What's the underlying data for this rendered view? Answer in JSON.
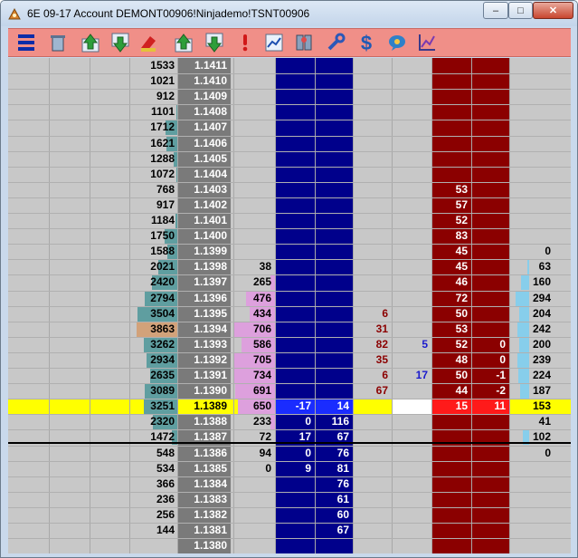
{
  "window": {
    "title": "6E 09-17  Account DEMONT00906!Ninjademo!TSNT00906",
    "controls": {
      "minimize": "–",
      "maximize": "□",
      "close": "✕"
    }
  },
  "toolbar": {
    "tools": [
      "center-ladder-icon",
      "trash-icon",
      "up-arrow-icon",
      "down-arrow-icon",
      "clear-orders-icon",
      "up-arrow-icon",
      "down-arrow-icon",
      "alert-icon",
      "chart-icon",
      "settings-icon",
      "wrench-icon",
      "dollar-icon",
      "chat-icon",
      "graph-icon"
    ]
  },
  "colors": {
    "price_col": "#7a7a7a",
    "buy_col": "#00008b",
    "sell_col": "#8b0000",
    "last_row": "#ffff00",
    "volume_bar": "#5f9ea0",
    "hi_vol_bar": "#d2a27a",
    "profile_bar": "#dda0dd",
    "right_bar": "#87ceeb"
  },
  "ladder": {
    "rows": [
      {
        "vol": "1533",
        "vbar": 0.0,
        "price": "1.1411"
      },
      {
        "vol": "1021",
        "vbar": 0.0,
        "price": "1.1410"
      },
      {
        "vol": "912",
        "vbar": 0.0,
        "price": "1.1409"
      },
      {
        "vol": "1101",
        "vbar": 0.05,
        "price": "1.1408"
      },
      {
        "vol": "1712",
        "vbar": 0.3,
        "price": "1.1407"
      },
      {
        "vol": "1621",
        "vbar": 0.28,
        "price": "1.1406"
      },
      {
        "vol": "1288",
        "vbar": 0.1,
        "price": "1.1405"
      },
      {
        "vol": "1072",
        "vbar": 0.05,
        "price": "1.1404"
      },
      {
        "vol": "768",
        "vbar": 0.0,
        "price": "1.1403",
        "sell": "53"
      },
      {
        "vol": "917",
        "vbar": 0.0,
        "price": "1.1402",
        "sell": "57"
      },
      {
        "vol": "1184",
        "vbar": 0.06,
        "price": "1.1401",
        "sell": "52"
      },
      {
        "vol": "1750",
        "vbar": 0.33,
        "price": "1.1400",
        "sell": "83"
      },
      {
        "vol": "1588",
        "vbar": 0.27,
        "price": "1.1399",
        "sell": "45",
        "r": "0"
      },
      {
        "vol": "2021",
        "vbar": 0.47,
        "price": "1.1398",
        "prof": "38",
        "sell": "45",
        "r": "63",
        "rbar": 0.1
      },
      {
        "vol": "2420",
        "vbar": 0.62,
        "price": "1.1397",
        "prof": "265",
        "pbar": 0.1,
        "sell": "46",
        "r": "160",
        "rbar": 0.4
      },
      {
        "vol": "2794",
        "vbar": 0.8,
        "price": "1.1396",
        "prof": "476",
        "pbar": 0.7,
        "sell": "72",
        "r": "294",
        "rbar": 0.7
      },
      {
        "vol": "3504",
        "vbar": 0.97,
        "price": "1.1395",
        "prof": "434",
        "pbar": 0.6,
        "sa": "6",
        "sell": "50",
        "r": "204",
        "rbar": 0.5
      },
      {
        "vol": "3863",
        "vbar": 1.0,
        "hi": true,
        "price": "1.1394",
        "prof": "706",
        "pbar": 1.0,
        "sa": "31",
        "sell": "53",
        "r": "242",
        "rbar": 0.6
      },
      {
        "vol": "3262",
        "vbar": 0.83,
        "price": "1.1393",
        "prof": "586",
        "pbar": 0.8,
        "sa": "82",
        "ba": "5",
        "sell": "52",
        "fill": "0",
        "r": "200",
        "rbar": 0.5
      },
      {
        "vol": "2934",
        "vbar": 0.75,
        "price": "1.1392",
        "prof": "705",
        "pbar": 1.0,
        "sa": "35",
        "sell": "48",
        "fill": "0",
        "r": "239",
        "rbar": 0.6
      },
      {
        "vol": "2635",
        "vbar": 0.68,
        "price": "1.1391",
        "prof": "734",
        "pbar": 1.0,
        "sa": "6",
        "ba": "17",
        "sell": "50",
        "fill": "-1",
        "r": "224",
        "rbar": 0.55
      },
      {
        "vol": "3089",
        "vbar": 0.8,
        "price": "1.1390",
        "prof": "691",
        "pbar": 0.95,
        "sa": "67",
        "sell": "44",
        "fill": "-2",
        "r": "187",
        "rbar": 0.45
      },
      {
        "vol": "3251",
        "vbar": 0.83,
        "price": "1.1389",
        "prof": "650",
        "pbar": 0.9,
        "bid": "-17",
        "ask": "14",
        "sell": "15",
        "fill": "11",
        "r": "153",
        "last": true
      },
      {
        "vol": "2320",
        "vbar": 0.6,
        "price": "1.1388",
        "prof": "233",
        "pbar": 0.1,
        "bid": "0",
        "ask": "116",
        "r": "41"
      },
      {
        "vol": "1472",
        "vbar": 0.15,
        "price": "1.1387",
        "prof": "72",
        "bid": "17",
        "ask": "67",
        "r": "102",
        "rbar": 0.3
      },
      {
        "vol": "548",
        "vbar": 0.0,
        "price": "1.1386",
        "prof": "94",
        "bid": "0",
        "ask": "76",
        "r": "0"
      },
      {
        "vol": "534",
        "vbar": 0.0,
        "price": "1.1385",
        "prof": "0",
        "bid": "9",
        "ask": "81"
      },
      {
        "vol": "366",
        "vbar": 0.0,
        "price": "1.1384",
        "ask": "76"
      },
      {
        "vol": "236",
        "vbar": 0.0,
        "price": "1.1383",
        "ask": "61"
      },
      {
        "vol": "256",
        "vbar": 0.0,
        "price": "1.1382",
        "ask": "60"
      },
      {
        "vol": "144",
        "vbar": 0.0,
        "price": "1.1381",
        "ask": "67"
      },
      {
        "price": "1.1380"
      }
    ]
  }
}
